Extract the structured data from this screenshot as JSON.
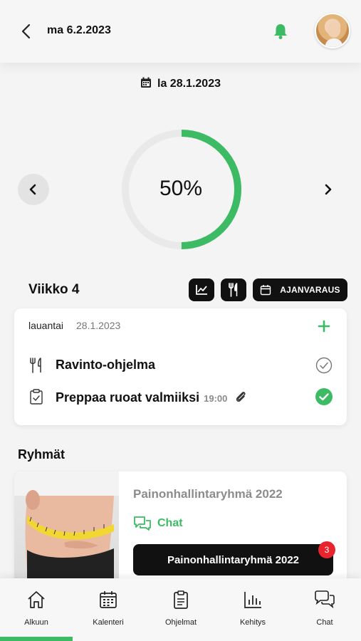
{
  "header": {
    "date": "ma 6.2.2023"
  },
  "selected_day": "la 28.1.2023",
  "progress": {
    "percent_label": "50%",
    "fraction": 0.5
  },
  "week": {
    "title": "Viikko 4",
    "booking_label": "AJANVARAUS"
  },
  "day_card": {
    "weekday": "lauantai",
    "date": "28.1.2023",
    "tasks": [
      {
        "label": "Ravinto-ohjelma",
        "time": "",
        "done": false
      },
      {
        "label": "Preppaa ruoat valmiiksi",
        "time": "19:00",
        "done": true
      }
    ]
  },
  "groups": {
    "title": "Ryhmät",
    "items": [
      {
        "name": "Painonhallintaryhmä 2022",
        "chat_label": "Chat",
        "button_label": "Painonhallintaryhmä 2022",
        "badge": "3"
      }
    ]
  },
  "tabs": [
    {
      "label": "Alkuun",
      "icon": "home-icon"
    },
    {
      "label": "Kalenteri",
      "icon": "calendar-icon"
    },
    {
      "label": "Ohjelmat",
      "icon": "clipboard-icon"
    },
    {
      "label": "Kehitys",
      "icon": "bar-chart-icon"
    },
    {
      "label": "Chat",
      "icon": "chat-bubbles-icon"
    }
  ],
  "colors": {
    "accent": "#3dbb64",
    "badge": "#e8242f",
    "dark": "#111111"
  }
}
